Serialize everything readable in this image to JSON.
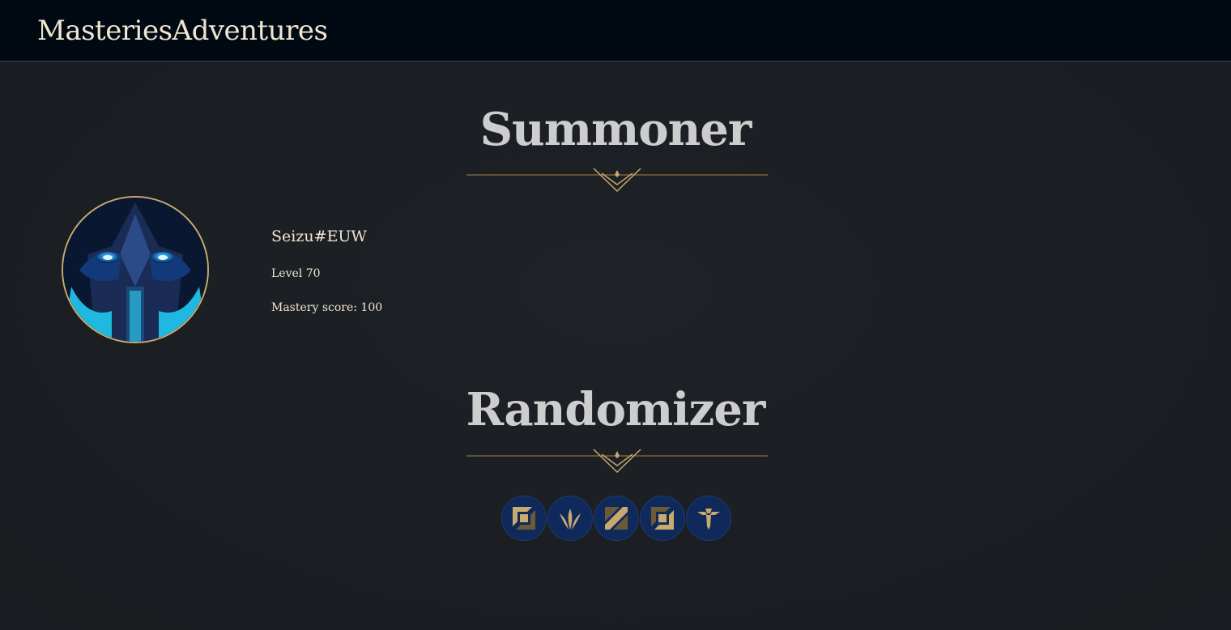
{
  "header": {
    "brand": "MasteriesAdventures"
  },
  "summoner": {
    "title": "Summoner",
    "riot_id": "Seizu#EUW",
    "level": "Level 70",
    "mastery_score": "Mastery score: 100",
    "avatar_icon": "summoner-profile-icon"
  },
  "randomizer": {
    "title": "Randomizer",
    "lanes": [
      {
        "name": "top",
        "icon": "top-lane-icon"
      },
      {
        "name": "jungle",
        "icon": "jungle-icon"
      },
      {
        "name": "mid",
        "icon": "mid-lane-icon"
      },
      {
        "name": "bottom",
        "icon": "bottom-lane-icon"
      },
      {
        "name": "support",
        "icon": "support-icon"
      }
    ]
  },
  "colors": {
    "accent_gold": "#c8aa6e",
    "text_cream": "#f0e6d2",
    "header_bg": "#010a13",
    "page_bg": "#1c1f24",
    "lane_bg": "#0f2a5a"
  }
}
